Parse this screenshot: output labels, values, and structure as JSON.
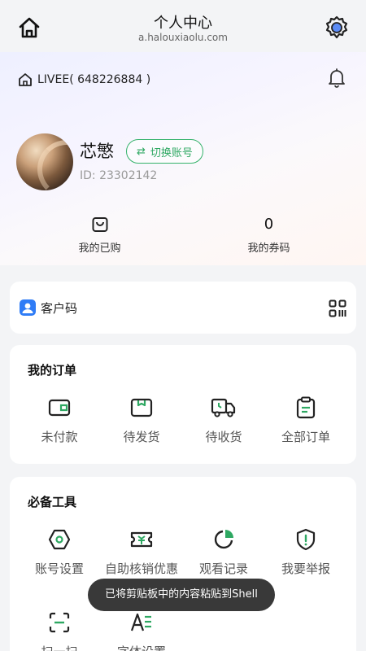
{
  "header": {
    "title": "个人中心",
    "subtitle": "a.halouxiaolu.com",
    "home_icon": "home-icon",
    "settings_icon": "gear-icon"
  },
  "profile": {
    "store_label": "LIVEE( 648226884 )",
    "name": "芯慜",
    "switch_label": "切换账号",
    "id_text": "ID: 23302142"
  },
  "stats": {
    "purchased_label": "我的已购",
    "coupons_count": "0",
    "coupons_label": "我的券码"
  },
  "customer_code": {
    "label": "客户码"
  },
  "orders": {
    "title": "我的订单",
    "items": [
      {
        "label": "未付款",
        "icon": "wallet-icon"
      },
      {
        "label": "待发货",
        "icon": "package-icon"
      },
      {
        "label": "待收货",
        "icon": "truck-icon"
      },
      {
        "label": "全部订单",
        "icon": "clipboard-icon"
      }
    ]
  },
  "tools": {
    "title": "必备工具",
    "items": [
      {
        "label": "账号设置",
        "icon": "hexagon-settings-icon"
      },
      {
        "label": "自助核销优惠",
        "icon": "ticket-icon"
      },
      {
        "label": "观看记录",
        "icon": "pie-chart-icon"
      },
      {
        "label": "我要举报",
        "icon": "report-shield-icon"
      },
      {
        "label": "扫一扫",
        "icon": "scan-icon"
      },
      {
        "label": "字体设置",
        "icon": "font-size-icon"
      }
    ]
  },
  "toast": {
    "text": "已将剪贴板中的内容粘贴到Shell"
  },
  "colors": {
    "accent_green": "#2ea862",
    "card_bg": "#ffffff",
    "page_bg": "#f3f4f6"
  }
}
